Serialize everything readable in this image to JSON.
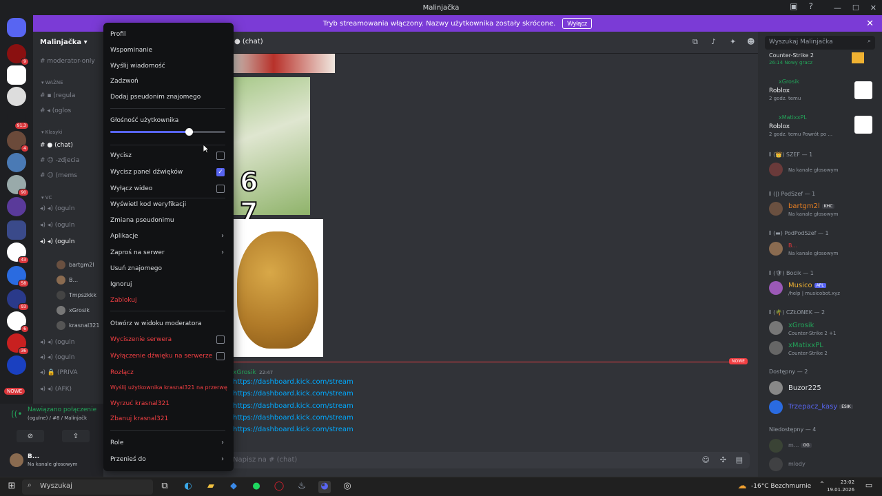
{
  "window": {
    "title": "Malinjačka"
  },
  "banner": {
    "text": "Tryb streamowania włączony. Nazwy użytkownika zostały skrócone.",
    "button": "Wyłącz"
  },
  "rail": {
    "badges": [
      "9",
      "91,3",
      "4",
      "90",
      "43",
      "58",
      "93",
      "6",
      "36"
    ],
    "new_badge": "NOWE"
  },
  "sidebar": {
    "server_name": "Malinjačka",
    "channels": [
      {
        "label": "moderator-only"
      },
      {
        "label": "WAŻNE",
        "category": true
      },
      {
        "label": "(regula"
      },
      {
        "label": "(oglos"
      },
      {
        "label": "Klasyki",
        "category": true
      },
      {
        "label": "(chat)"
      },
      {
        "label": "-zdjecia"
      },
      {
        "label": "(mems"
      },
      {
        "label": "VC",
        "category": true
      },
      {
        "label": "(oguln"
      },
      {
        "label": "(oguln"
      },
      {
        "label": "(oguln"
      },
      {
        "label": "(oguln"
      },
      {
        "label": "(oguln"
      },
      {
        "label": "(PRIVA"
      },
      {
        "label": "(AFK)"
      }
    ],
    "voice_users": [
      "bartgm2l",
      "B...",
      "Tmpszkkk",
      "xGrosik",
      "krasnal321"
    ]
  },
  "connection": {
    "title": "Nawiązano połączenie",
    "subtitle": "(ogulne) / #8 / Malinjačk",
    "user_name": "B...",
    "user_status": "Na kanale głosowym"
  },
  "chat": {
    "channel": "(chat)",
    "image_text": "6 7",
    "new_tag": "NOWE",
    "author": "xGrosik",
    "time": "22:47",
    "links": [
      "https://dashboard.kick.com/stream",
      "https://dashboard.kick.com/stream",
      "https://dashboard.kick.com/stream",
      "https://dashboard.kick.com/stream",
      "https://dashboard.kick.com/stream"
    ],
    "composer_placeholder": "Napisz na #  (chat)"
  },
  "members": {
    "search_placeholder": "Wyszukaj Malinjačka",
    "activity": [
      {
        "name": "Counter-Strike 2",
        "sub": "26:14  Nowy gracz"
      },
      {
        "user": "xGrosik",
        "game": "Roblox",
        "sub": "2 godz. temu"
      },
      {
        "user": "xMatixxPL",
        "game": "Roblox",
        "sub": "2 godz. temu  Powrót po ..."
      }
    ],
    "groups": [
      {
        "title": "SZEF — 1",
        "members": [
          {
            "name": "",
            "sub": "Na kanale głosowym",
            "color": "#f2f3f5"
          }
        ]
      },
      {
        "title": "PodSzef — 1",
        "members": [
          {
            "name": "bartgm2l",
            "tag": "KHC",
            "sub": "Na kanale głosowym",
            "color": "#e67e22"
          }
        ]
      },
      {
        "title": "PodPodSzef — 1",
        "members": [
          {
            "name": "B...",
            "sub": "Na kanale głosowym",
            "color": "#da373c"
          }
        ]
      },
      {
        "title": "Bocik — 1",
        "members": [
          {
            "name": "Musico",
            "tag": "APL",
            "sub": "/help | musicobot.xyz",
            "color": "#f0b232"
          }
        ]
      },
      {
        "title": "CZŁONEK — 2",
        "members": [
          {
            "name": "xGrosik",
            "sub": "Counter-Strike 2 +1",
            "color": "#23a55a"
          },
          {
            "name": "xMatixxPL",
            "sub": "Counter-Strike 2",
            "color": "#23a55a"
          }
        ]
      },
      {
        "title": "Dostępny — 2",
        "members": [
          {
            "name": "Buzor225",
            "sub": "",
            "color": "#dbdee1"
          },
          {
            "name": "Trzepacz_kasy",
            "tag": "ESIK",
            "sub": "",
            "color": "#5865f2"
          }
        ]
      },
      {
        "title": "Niedostępny — 4",
        "members": [
          {
            "name": "m...",
            "tag": "GG",
            "sub": "",
            "color": "#80848e"
          },
          {
            "name": "mlody",
            "sub": "",
            "color": "#80848e"
          }
        ]
      }
    ]
  },
  "menu": {
    "items_top": [
      "Profil",
      "Wspominanie",
      "Wyślij wiadomość",
      "Zadzwoń",
      "Dodaj pseudonim znajomego"
    ],
    "volume_label": "Głośność użytkownika",
    "volume_value": 0.68,
    "checks": [
      {
        "label": "Wycisz",
        "checked": false
      },
      {
        "label": "Wycisz panel dźwięków",
        "checked": true
      },
      {
        "label": "Wyłącz wideo",
        "checked": false
      }
    ],
    "items_mid": [
      "Wyświetl kod weryfikacji",
      "Zmiana pseudonimu"
    ],
    "submenus": [
      "Aplikacje",
      "Zaproś na serwer"
    ],
    "items_mid2": [
      "Usuń znajomego",
      "Ignoruj"
    ],
    "block": "Zablokuj",
    "mod_view": "Otwórz w widoku moderatora",
    "mod_checks": [
      {
        "label": "Wyciszenie serwera",
        "checked": false
      },
      {
        "label": "Wyłączenie dźwięku na serwerze",
        "checked": false
      }
    ],
    "danger_items": [
      "Rozłącz",
      "Wyślij użytkownika krasnal321 na przerwę",
      "Wyrzuć krasnal321",
      "Zbanuj krasnal321"
    ],
    "bottom_submenus": [
      "Role",
      "Przenieś do"
    ]
  },
  "taskbar": {
    "search": "Wyszukaj",
    "weather": "-16°C  Bezchmurnie",
    "time": "23:02",
    "date": "19.01.2026"
  }
}
